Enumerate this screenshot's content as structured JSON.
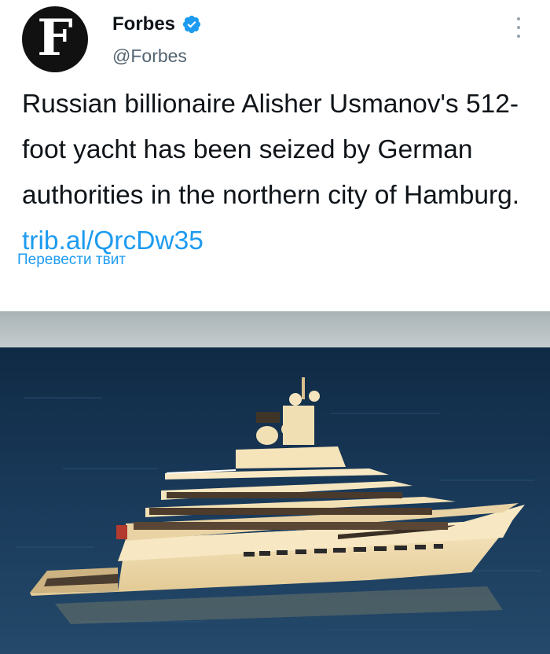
{
  "author": {
    "avatar_letter": "F",
    "display_name": "Forbes",
    "handle": "@Forbes",
    "verified_icon": "verified-badge-icon",
    "verified_color": "#1d9bf0"
  },
  "tweet": {
    "text": "Russian billionaire Alisher Usmanov's 512-foot yacht has been seized by German authorities in the northern city of Hamburg.",
    "link": "trib.al/QrcDw35",
    "link_color": "#1d9bf0"
  },
  "translate_label": "Перевести твит",
  "more_icon": "more-vertical-icon",
  "media": {
    "subject": "yacht-photo",
    "sea_color": "#16324d",
    "sky_color": "#b9c4c8",
    "hull_color": "#f3e4bf"
  }
}
